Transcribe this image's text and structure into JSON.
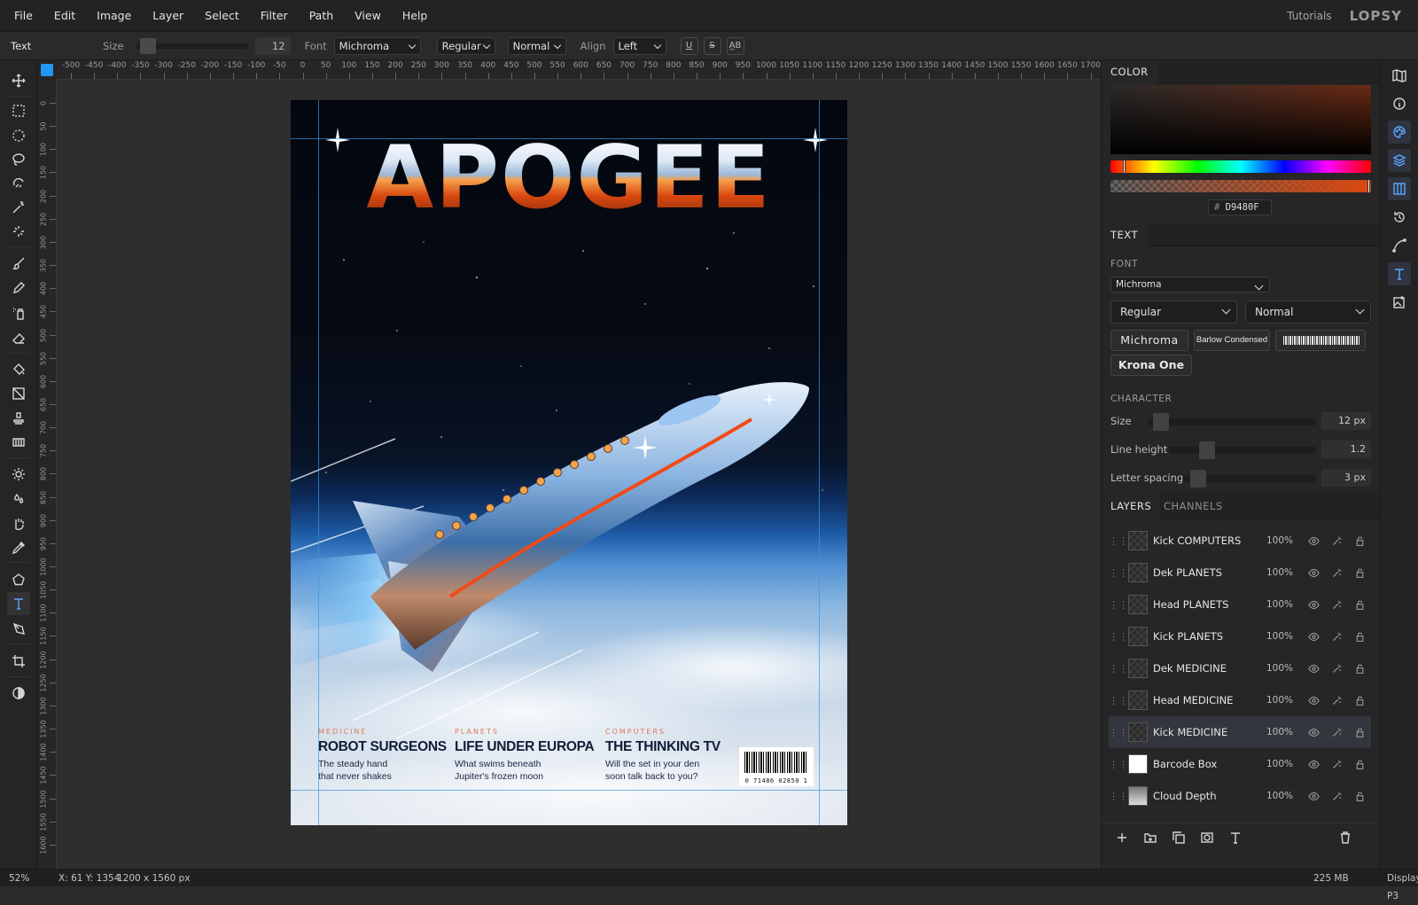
{
  "menu": [
    "File",
    "Edit",
    "Image",
    "Layer",
    "Select",
    "Filter",
    "Path",
    "View",
    "Help"
  ],
  "top_right": {
    "tutorials": "Tutorials",
    "logo": "LOPSY"
  },
  "options": {
    "tool_name": "Text",
    "size_label": "Size",
    "size_value": "12",
    "font_label": "Font",
    "font_value": "Michroma",
    "weight_value": "Regular",
    "style_value": "Normal",
    "align_label": "Align",
    "align_value": "Left",
    "underline": "U",
    "strike": "S",
    "case": "A̲B"
  },
  "ruler": {
    "top": [
      "-500",
      "-450",
      "-400",
      "-350",
      "-300",
      "-250",
      "-200",
      "-150",
      "-100",
      "-50",
      "0",
      "50",
      "100",
      "150",
      "200",
      "250",
      "300",
      "350",
      "400",
      "450",
      "500",
      "550",
      "600",
      "650",
      "700",
      "750",
      "800",
      "850",
      "900",
      "950",
      "1000",
      "1050",
      "1100",
      "1150",
      "1200",
      "1250",
      "1300",
      "1350",
      "1400",
      "1450",
      "1500",
      "1550",
      "1600",
      "1650",
      "1700"
    ],
    "left": [
      "0",
      "50",
      "100",
      "150",
      "200",
      "250",
      "300",
      "350",
      "400",
      "450",
      "500",
      "550",
      "600",
      "650",
      "700",
      "750",
      "800",
      "850",
      "900",
      "950",
      "1000",
      "1050",
      "1100",
      "1150",
      "1200",
      "1250",
      "1300",
      "1350",
      "1400",
      "1450",
      "1500",
      "1550",
      "1600"
    ]
  },
  "cover": {
    "title": "APOGEE",
    "stories": [
      {
        "kick": "MEDICINE",
        "head": "ROBOT SURGEONS",
        "dek": "The steady hand\nthat never shakes"
      },
      {
        "kick": "PLANETS",
        "head": "LIFE UNDER EUROPA",
        "dek": "What swims beneath\nJupiter's frozen moon"
      },
      {
        "kick": "COMPUTERS",
        "head": "THE THINKING TV",
        "dek": "Will the set in your den\nsoon talk back to you?"
      }
    ],
    "barcode_number": "0 71486 02850 1"
  },
  "color_panel": {
    "tab": "COLOR",
    "hex_prefix": "#",
    "hex": "D9480F",
    "accent": "#D9480F"
  },
  "text_panel": {
    "tab": "TEXT",
    "font_label": "FONT",
    "font_value": "Michroma",
    "weight_value": "Regular",
    "style_value": "Normal",
    "font_chips": [
      "Michroma",
      "Barlow Condensed",
      "",
      "Krona One"
    ],
    "character_label": "CHARACTER",
    "size_label": "Size",
    "size_value": "12 px",
    "line_height_label": "Line height",
    "line_height_value": "1.2",
    "letter_spacing_label": "Letter spacing",
    "letter_spacing_value": "3 px"
  },
  "layers_panel": {
    "tabs": [
      "LAYERS",
      "CHANNELS"
    ],
    "layers": [
      {
        "name": "Kick COMPUTERS",
        "opacity": "100%"
      },
      {
        "name": "Dek PLANETS",
        "opacity": "100%"
      },
      {
        "name": "Head PLANETS",
        "opacity": "100%"
      },
      {
        "name": "Kick PLANETS",
        "opacity": "100%"
      },
      {
        "name": "Dek MEDICINE",
        "opacity": "100%"
      },
      {
        "name": "Head MEDICINE",
        "opacity": "100%"
      },
      {
        "name": "Kick MEDICINE",
        "opacity": "100%",
        "selected": true
      },
      {
        "name": "Barcode Box",
        "opacity": "100%"
      },
      {
        "name": "Cloud Depth",
        "opacity": "100%"
      }
    ]
  },
  "status": {
    "zoom": "52%",
    "coords": "X: 61 Y: 1354",
    "dims": "1200 x 1560 px",
    "memory": "225 MB",
    "profile": "Display P3"
  }
}
